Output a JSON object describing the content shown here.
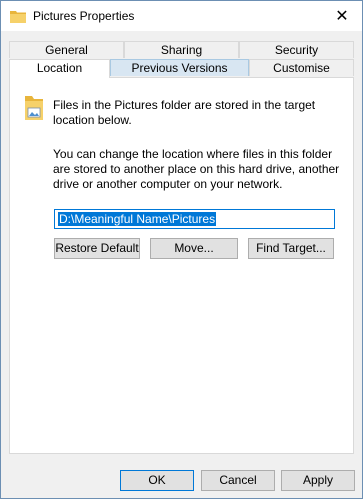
{
  "window": {
    "title": "Pictures Properties",
    "close_glyph": "✕"
  },
  "tabs_back": [
    "General",
    "Sharing",
    "Security"
  ],
  "tabs_front": [
    "Location",
    "Previous Versions",
    "Customise"
  ],
  "location": {
    "info": "Files in the Pictures folder are stored in the target location below.",
    "description": "You can change the location where files in this folder are stored to another place on this hard drive, another drive or another computer on your network.",
    "path": "D:\\Meaningful Name\\Pictures"
  },
  "buttons": {
    "restore_default": "Restore Default",
    "move": "Move...",
    "find_target": "Find Target...",
    "ok": "OK",
    "cancel": "Cancel",
    "apply": "Apply"
  },
  "colors": {
    "accent": "#0078d7",
    "folder": "#e8b53c"
  }
}
